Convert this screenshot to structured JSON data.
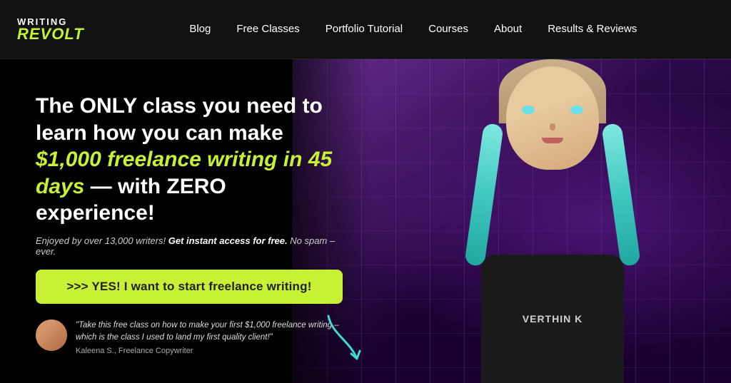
{
  "nav": {
    "logo": {
      "writing": "WRITING",
      "revolt": "REVOLT"
    },
    "links": [
      {
        "label": "Blog",
        "id": "blog"
      },
      {
        "label": "Free Classes",
        "id": "free-classes"
      },
      {
        "label": "Portfolio Tutorial",
        "id": "portfolio-tutorial"
      },
      {
        "label": "Courses",
        "id": "courses"
      },
      {
        "label": "About",
        "id": "about"
      },
      {
        "label": "Results & Reviews",
        "id": "results-reviews"
      }
    ]
  },
  "hero": {
    "headline_part1": "The ONLY class you need to learn how you can make ",
    "headline_accent": "$1,000 freelance writing in 45 days",
    "headline_part2": " — with ZERO experience!",
    "subtext_normal1": "Enjoyed by over 13,000 writers! ",
    "subtext_bold": "Get instant access for free.",
    "subtext_normal2": " No spam – ever.",
    "cta_label": ">>> YES! I want to start freelance writing!",
    "testimonial_quote": "\"Take this free class on how to make your first $1,000 freelance writing – which is the class I used to land my first quality client!\"",
    "testimonial_author": "Kaleena S., Freelance Copywriter",
    "shirt_text": "VERTHIN K"
  }
}
